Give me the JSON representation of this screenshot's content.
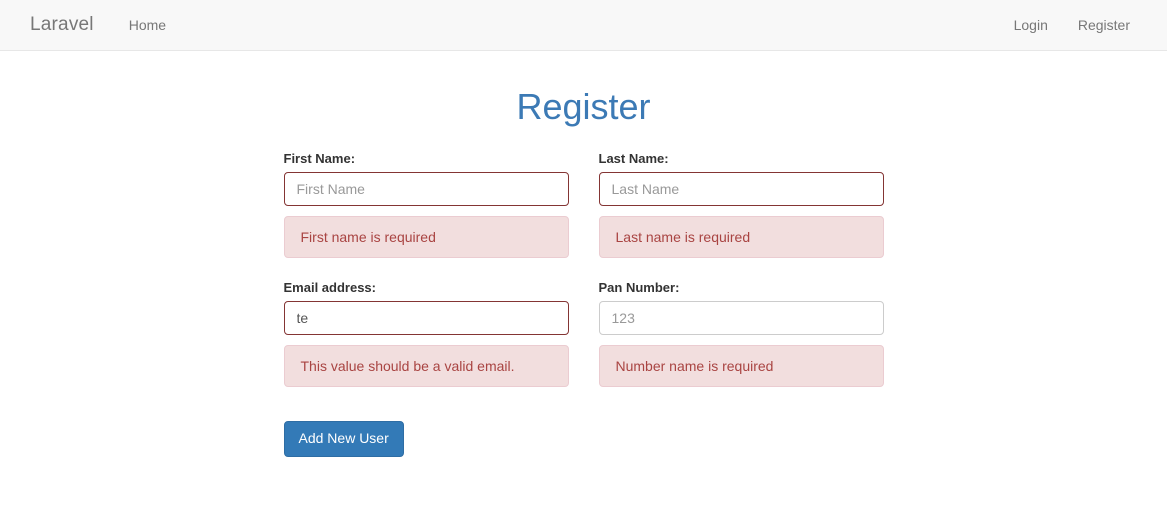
{
  "navbar": {
    "brand": "Laravel",
    "left_links": [
      {
        "label": "Home"
      }
    ],
    "right_links": [
      {
        "label": "Login"
      },
      {
        "label": "Register"
      }
    ]
  },
  "page": {
    "title": "Register",
    "title_color": "#3c7ab5"
  },
  "form": {
    "fields": [
      {
        "label": "First Name:",
        "placeholder": "First Name",
        "value": "",
        "error": "First name is required",
        "state": "error"
      },
      {
        "label": "Last Name:",
        "placeholder": "Last Name",
        "value": "",
        "error": "Last name is required",
        "state": "error"
      },
      {
        "label": "Email address:",
        "placeholder": "",
        "value": "te",
        "error": "This value should be a valid email.",
        "state": "error"
      },
      {
        "label": "Pan Number:",
        "placeholder": "123",
        "value": "",
        "error": "Number name is required",
        "state": "normal"
      }
    ],
    "submit_label": "Add New User"
  },
  "colors": {
    "navbar_bg": "#f8f8f8",
    "navbar_border": "#e7e7e7",
    "primary": "#337ab7",
    "error_bg": "#f2dede",
    "error_text": "#a94442",
    "error_border": "#843534"
  }
}
